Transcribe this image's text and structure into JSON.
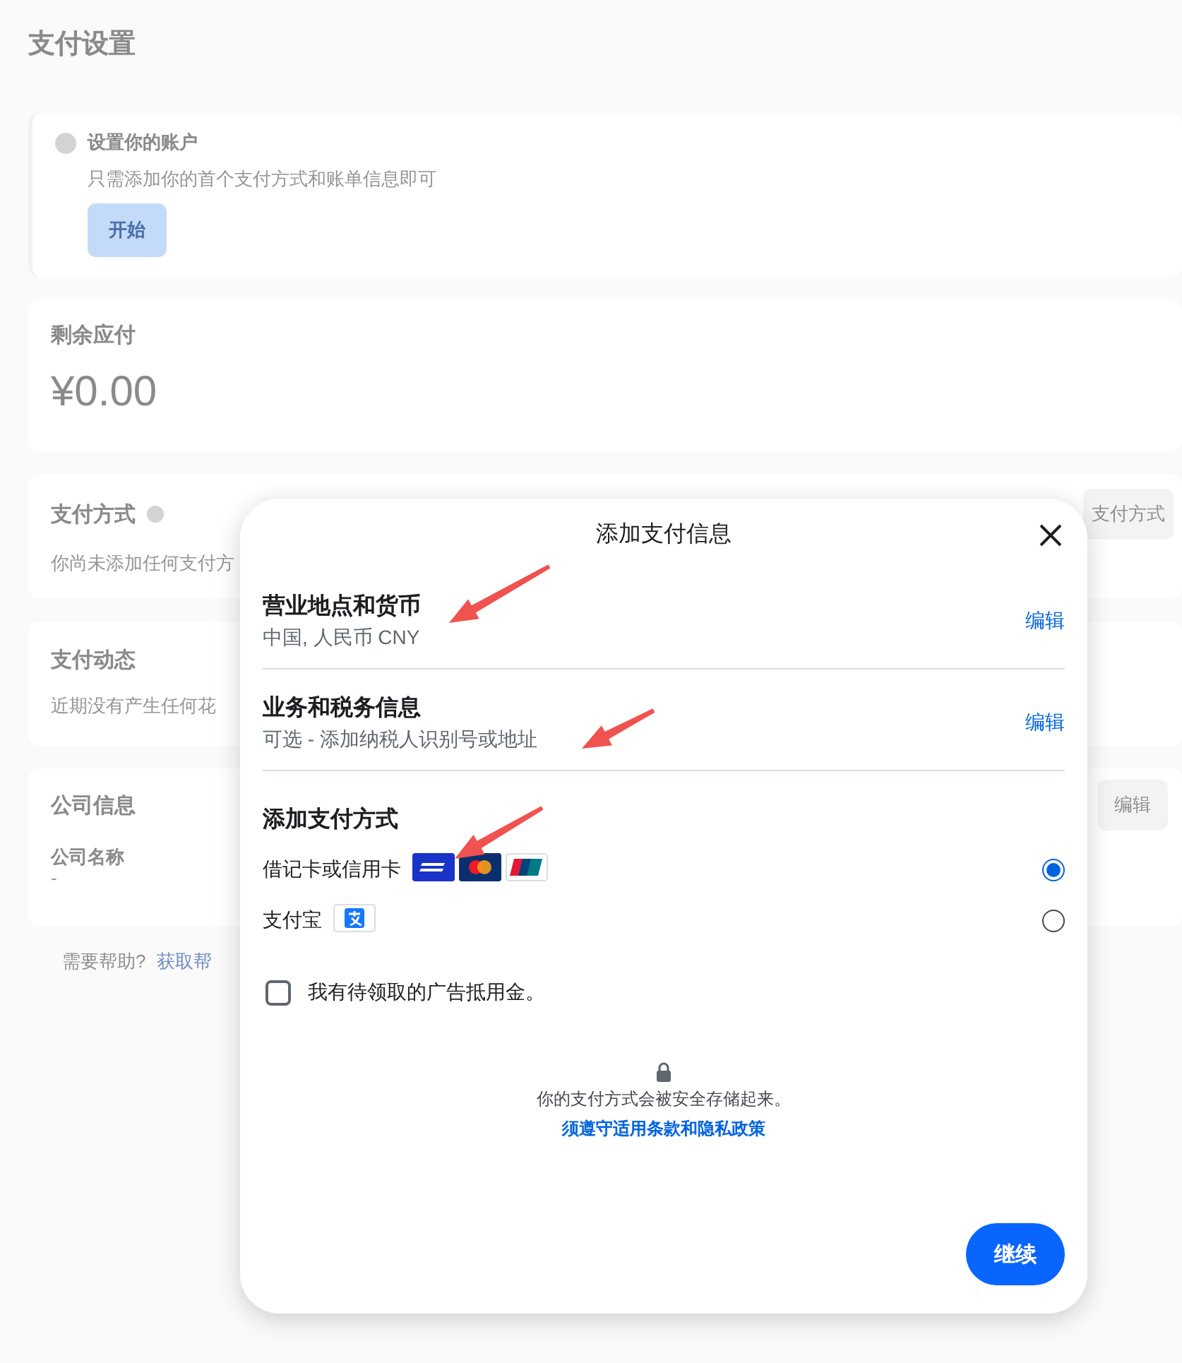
{
  "page": {
    "title": "支付设置",
    "setup_banner": {
      "title": "设置你的账户",
      "text": "只需添加你的首个支付方式和账单信息即可",
      "button": "开始"
    },
    "balance": {
      "title": "剩余应付",
      "amount": "¥0.00"
    },
    "payment_methods": {
      "title": "支付方式",
      "text": "你尚未添加任何支付方",
      "button": "支付方式"
    },
    "activity": {
      "title": "支付动态",
      "text": "近期没有产生任何花"
    },
    "company": {
      "title": "公司信息",
      "button": "编辑",
      "field_label": "公司名称",
      "field_value": "-"
    },
    "help": {
      "text": "需要帮助?",
      "link": "获取帮"
    }
  },
  "dialog": {
    "title": "添加支付信息",
    "sections": [
      {
        "title": "营业地点和货币",
        "subtitle": "中国, 人民币 CNY",
        "action": "编辑"
      },
      {
        "title": "业务和税务信息",
        "subtitle": "可选 - 添加纳税人识别号或地址",
        "action": "编辑"
      }
    ],
    "payment": {
      "title": "添加支付方式",
      "options": [
        {
          "kind": "card",
          "label": "借记卡或信用卡",
          "selected": true
        },
        {
          "kind": "alipay",
          "label": "支付宝",
          "selected": false
        }
      ]
    },
    "coupon": {
      "label": "我有待领取的广告抵用金。",
      "checked": false
    },
    "security": {
      "text": "你的支付方式会被安全存储起来。",
      "link": "须遵守适用条款和隐私政策"
    },
    "continue_button": "继续"
  }
}
